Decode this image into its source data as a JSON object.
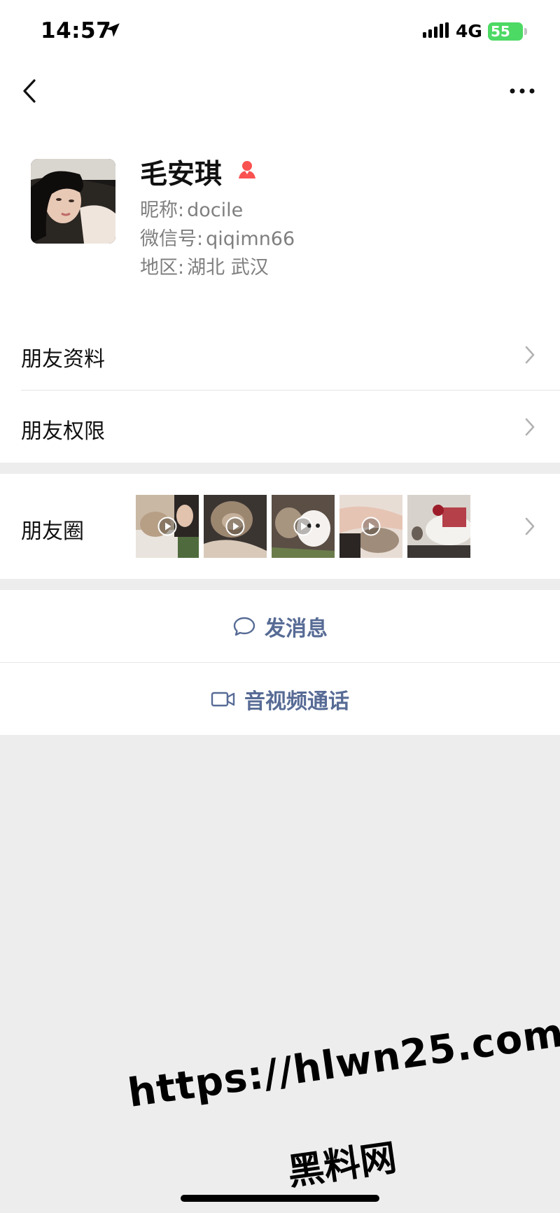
{
  "status_bar": {
    "time": "14:57",
    "network": "4G",
    "battery": "55"
  },
  "profile": {
    "name": "毛安琪",
    "nickname_label": "昵称:",
    "nickname": "docile",
    "wechat_id_label": "微信号:",
    "wechat_id": "qiqimn66",
    "region_label": "地区:",
    "region": "湖北 武汉",
    "gender_icon": "female-person-icon",
    "gender_color": "#fa5151"
  },
  "menu": {
    "friend_info": "朋友资料",
    "friend_permissions": "朋友权限",
    "moments": "朋友圈"
  },
  "moments_thumbs": [
    {
      "icon": "play-icon",
      "has_play": true
    },
    {
      "icon": "play-icon",
      "has_play": true
    },
    {
      "icon": "play-icon",
      "has_play": true
    },
    {
      "icon": "play-icon",
      "has_play": true
    },
    {
      "icon": "",
      "has_play": false
    }
  ],
  "actions": {
    "send_message": "发消息",
    "video_call": "音视频通话",
    "accent_color": "#576b95"
  },
  "watermark": {
    "url": "https://hlwn25.com",
    "text": "黑料网"
  }
}
